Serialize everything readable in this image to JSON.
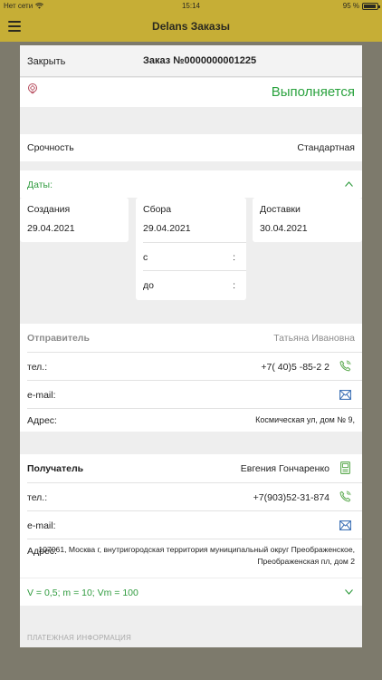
{
  "status_bar": {
    "carrier": "Нет сети",
    "time": "15:14",
    "battery": "95 %"
  },
  "nav": {
    "title": "Delans Заказы"
  },
  "header": {
    "close_label": "Закрыть",
    "order_title": "Заказ №0000000001225"
  },
  "order": {
    "status": "Выполняется"
  },
  "urgency": {
    "label": "Срочность",
    "value": "Стандартная"
  },
  "dates": {
    "section_label": "Даты:",
    "created": {
      "label": "Создания",
      "value": "29.04.2021"
    },
    "pickup": {
      "label": "Сбора",
      "value": "29.04.2021",
      "from_label": "с",
      "to_label": "до",
      "sep": ":"
    },
    "delivery": {
      "label": "Доставки",
      "value": "30.04.2021"
    }
  },
  "sender": {
    "title": "Отправитель",
    "name": "Татьяна Ивановна",
    "phone_label": "тел.:",
    "phone": "+7( 40)5 -85-2 2",
    "email_label": "e-mail:",
    "address_label": "Адрес:",
    "address": "Космическая ул, дом № 9,"
  },
  "recipient": {
    "title": "Получатель",
    "name": "Евгения Гончаренко",
    "phone_label": "тел.:",
    "phone": "+7(903)52-31-874",
    "email_label": "e-mail:",
    "address_label": "Адрес:",
    "address_line1": "107061, Москва г, внутригородская территория муниципальный округ Преображенское,",
    "address_line2": "Преображенская пл, дом 2"
  },
  "parcel": {
    "summary": "V = 0,5; m = 10; Vm = 100"
  },
  "payment": {
    "section_label": "ПЛАТЕЖНАЯ ИНФОРМАЦИЯ"
  },
  "colors": {
    "accent_yellow": "#c6ae36",
    "status_green": "#2aa23e",
    "link_green": "#2f9b3e",
    "icon_blue": "#3b6fb5"
  }
}
